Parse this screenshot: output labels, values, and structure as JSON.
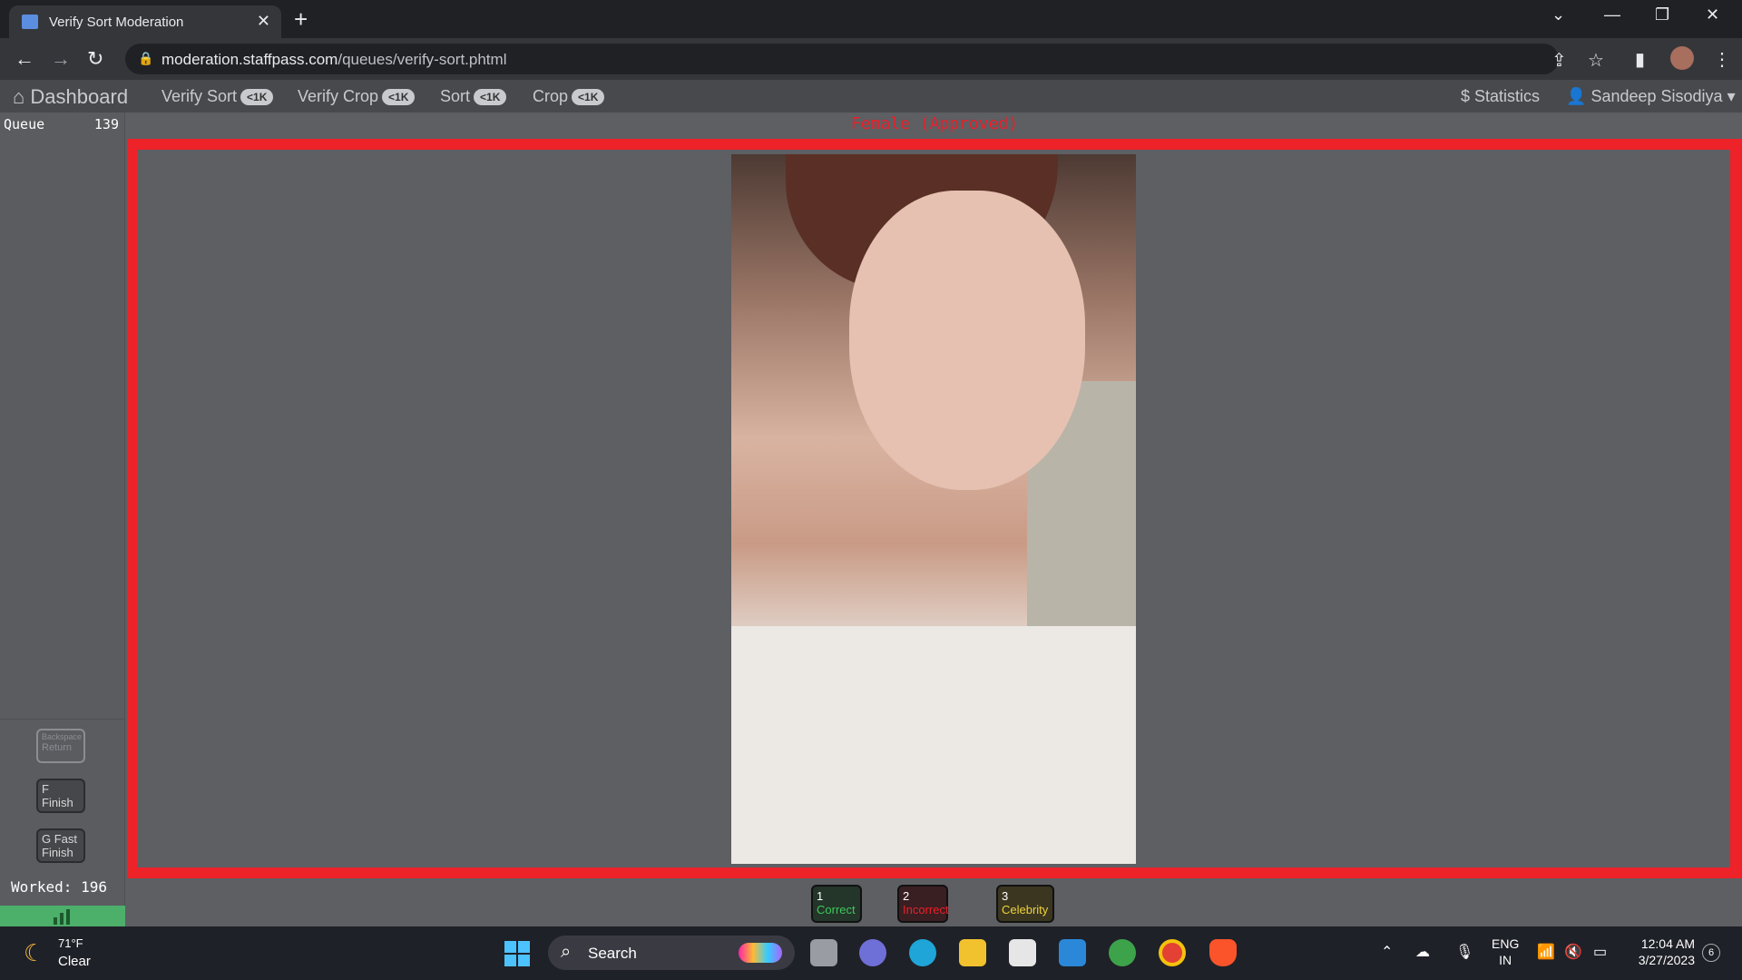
{
  "browser": {
    "tab_title": "Verify Sort Moderation",
    "url_domain": "moderation.staffpass.com",
    "url_path": "/queues/verify-sort.phtml"
  },
  "nav": {
    "dashboard": "Dashboard",
    "items": [
      {
        "label": "Verify Sort",
        "badge": "<1K"
      },
      {
        "label": "Verify Crop",
        "badge": "<1K"
      },
      {
        "label": "Sort",
        "badge": "<1K"
      },
      {
        "label": "Crop",
        "badge": "<1K"
      }
    ],
    "statistics": "$ Statistics",
    "user": "Sandeep Sisodiya"
  },
  "sidebar": {
    "queue_label": "Queue",
    "queue_count": "139",
    "keys": {
      "return_key": "Backspace",
      "return_label": "Return",
      "finish_key": "F",
      "finish_label": "Finish",
      "fast_key": "G Fast",
      "fast_label": "Finish"
    },
    "worked": "Worked: 196"
  },
  "main": {
    "status": "Female (Approved)"
  },
  "actions": [
    {
      "key": "1",
      "label": "Correct"
    },
    {
      "key": "2",
      "label": "Incorrect"
    },
    {
      "key": "3",
      "label": "Celebrity"
    }
  ],
  "taskbar": {
    "temp": "71°F",
    "weather": "Clear",
    "search": "Search",
    "lang1": "ENG",
    "lang2": "IN",
    "time": "12:04 AM",
    "date": "3/27/2023",
    "notifications": "6"
  },
  "colors": {
    "frame": "#ee2229",
    "status": "#e8202a",
    "correct": "#3ec95b",
    "incorrect": "#e8202a",
    "celebrity": "#f0d33a"
  }
}
